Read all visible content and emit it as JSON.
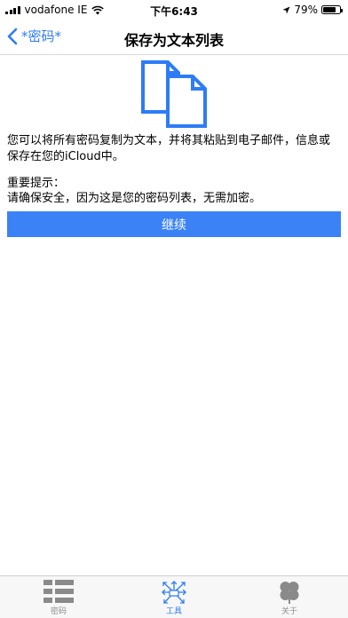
{
  "status_bar": {
    "carrier": "vodafone IE",
    "time": "下午6:43",
    "battery_percent": "79%",
    "battery_level": 0.79,
    "icons": [
      "signal-icon",
      "wifi-icon",
      "location-icon",
      "battery-icon"
    ]
  },
  "nav": {
    "back_label": "*密码*",
    "title": "保存为文本列表"
  },
  "content": {
    "description": "您可以将所有密码复制为文本，并将其粘贴到电子邮件，信息或保存在您的iCloud中。",
    "note_title": "重要提示：",
    "note_body": "请确保安全，因为这是您的密码列表，无需加密。",
    "continue_label": "继续",
    "icon": "copy-documents-icon"
  },
  "tabs": [
    {
      "label": "密码",
      "icon": "list-icon",
      "active": false
    },
    {
      "label": "工具",
      "icon": "tools-icon",
      "active": true
    },
    {
      "label": "关于",
      "icon": "clover-icon",
      "active": false
    }
  ],
  "colors": {
    "accent": "#2d7cf6",
    "button": "#3b82f6",
    "tab_inactive": "#8e8e8e"
  }
}
